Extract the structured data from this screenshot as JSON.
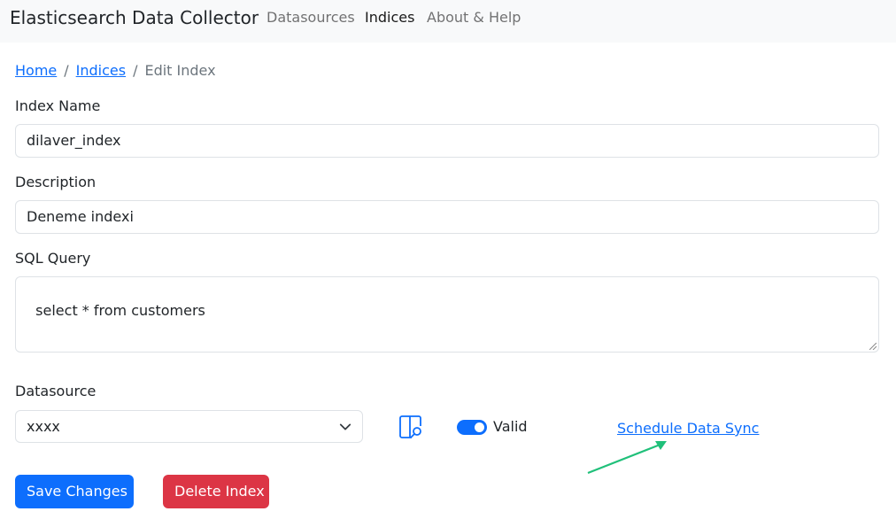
{
  "navbar": {
    "brand": "Elasticsearch Data Collector",
    "links": [
      {
        "label": "Datasources"
      },
      {
        "label": "Indices"
      },
      {
        "label": "About & Help"
      }
    ]
  },
  "breadcrumb": {
    "home": "Home",
    "indices": "Indices",
    "current": "Edit Index",
    "separator": "/"
  },
  "form": {
    "index_name_label": "Index Name",
    "index_name_value": "dilaver_index",
    "description_label": "Description",
    "description_value": "Deneme indexi",
    "sql_label": "SQL Query",
    "sql_value": "select * from customers",
    "datasource_label": "Datasource",
    "datasource_selected": "xxxx",
    "valid_label": "Valid",
    "valid_checked": true,
    "schedule_link": "Schedule Data Sync",
    "save_label": "Save Changes",
    "delete_label": "Delete Index"
  },
  "icons": {
    "datasource_browse": "panel-search-icon",
    "select_chevron": "chevron-down-icon",
    "annotation_arrow": "arrow-icon"
  },
  "colors": {
    "primary": "#0d6efd",
    "danger": "#dc3545",
    "annotation": "#20c07a"
  }
}
